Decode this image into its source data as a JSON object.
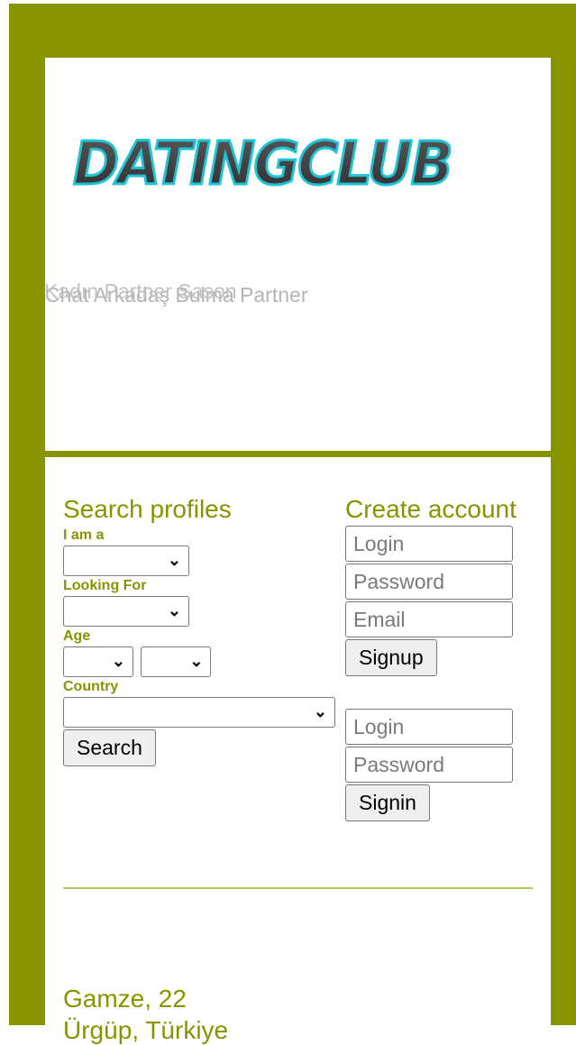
{
  "header": {
    "logo_text": "DATINGCLUB",
    "tagline_back": "Chat Arkadaş Bulma Partner",
    "tagline_front": "Kadın Partner Sason"
  },
  "search": {
    "title": "Search profiles",
    "i_am_label": "I am a",
    "looking_for_label": "Looking For",
    "age_label": "Age",
    "country_label": "Country",
    "search_button": "Search"
  },
  "signup": {
    "title": "Create account",
    "login_placeholder": "Login",
    "password_placeholder": "Password",
    "email_placeholder": "Email",
    "signup_button": "Signup"
  },
  "signin": {
    "login_placeholder": "Login",
    "password_placeholder": "Password",
    "signin_button": "Signin"
  },
  "profile": {
    "name_age": "Gamze, 22",
    "location": "Ürgüp, Türkiye"
  },
  "colors": {
    "brand_olive": "#879400",
    "logo_cyan": "#1ec3d6",
    "logo_dark": "#3b3b3b"
  }
}
